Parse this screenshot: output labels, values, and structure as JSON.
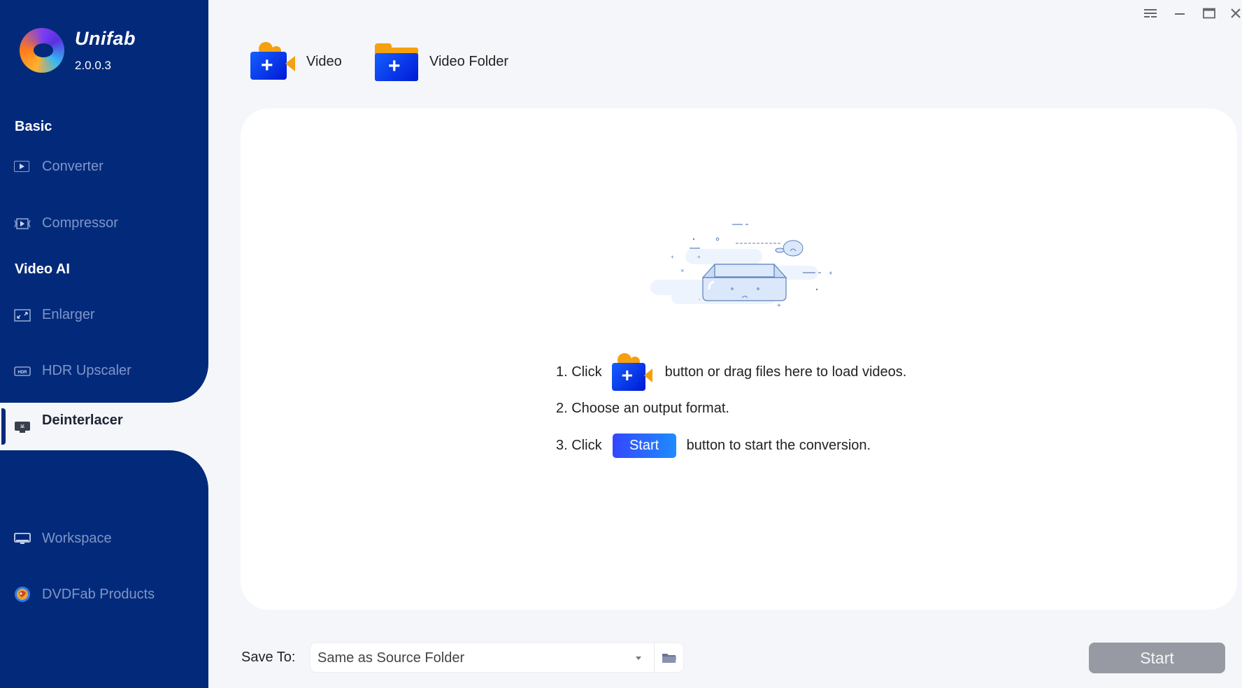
{
  "app": {
    "name": "Unifab",
    "version": "2.0.0.3"
  },
  "window_controls": {
    "menu": "menu-icon",
    "minimize": "minimize-icon",
    "maximize": "maximize-icon",
    "close": "close-icon"
  },
  "sidebar": {
    "sections": [
      {
        "label": "Basic",
        "items": [
          {
            "label": "Converter",
            "icon": "converter-icon"
          },
          {
            "label": "Compressor",
            "icon": "compressor-icon"
          }
        ]
      },
      {
        "label": "Video AI",
        "items": [
          {
            "label": "Enlarger",
            "icon": "enlarger-icon"
          },
          {
            "label": "HDR Upscaler",
            "icon": "hdr-icon"
          },
          {
            "label": "Deinterlacer",
            "icon": "deinterlacer-icon",
            "active": true
          }
        ]
      }
    ],
    "footer_items": [
      {
        "label": "Workspace",
        "icon": "monitor-icon"
      },
      {
        "label": "DVDFab Products",
        "icon": "dvdfab-icon"
      }
    ]
  },
  "toolbar": {
    "add_video_label": "Video",
    "add_folder_label": "Video Folder"
  },
  "empty_state": {
    "step1_prefix": "1. Click",
    "step1_suffix": "button or drag files here to load videos.",
    "step2": "2. Choose an output format.",
    "step3_prefix": "3. Click",
    "step3_button": "Start",
    "step3_suffix": "button to start the conversion."
  },
  "bottom_bar": {
    "save_to_label": "Save To:",
    "save_to_value": "Same as Source Folder",
    "start_label": "Start"
  },
  "colors": {
    "sidebar_bg": "#032a7a",
    "accent_blue": "#1560ff",
    "accent_orange": "#f5a00f",
    "start_disabled": "#979aa2"
  }
}
